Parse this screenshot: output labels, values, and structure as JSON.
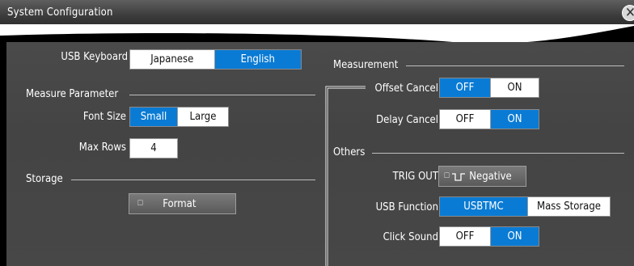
{
  "window": {
    "title": "System Configuration",
    "close_glyph": "✕"
  },
  "usb_keyboard": {
    "label": "USB Keyboard",
    "options": [
      "Japanese",
      "English"
    ],
    "selected": "English"
  },
  "measure_parameter": {
    "section": "Measure Parameter",
    "font_size": {
      "label": "Font Size",
      "options": [
        "Small",
        "Large"
      ],
      "selected": "Small"
    },
    "max_rows": {
      "label": "Max Rows",
      "value": "4"
    }
  },
  "storage": {
    "section": "Storage",
    "format_button": {
      "icon": "menu-icon",
      "label": "Format"
    }
  },
  "measurement": {
    "section": "Measurement",
    "offset_cancel": {
      "label": "Offset Cancel",
      "options": [
        "OFF",
        "ON"
      ],
      "selected": "OFF"
    },
    "delay_cancel": {
      "label": "Delay Cancel",
      "options": [
        "OFF",
        "ON"
      ],
      "selected": "ON"
    }
  },
  "others": {
    "section": "Others",
    "trig_out": {
      "label": "TRIG OUT",
      "icon": "menu-icon",
      "waveform_icon": "negative-pulse-icon",
      "value": "Negative"
    },
    "usb_function": {
      "label": "USB Function",
      "options": [
        "USBTMC",
        "Mass Storage"
      ],
      "selected": "USBTMC"
    },
    "click_sound": {
      "label": "Click Sound",
      "options": [
        "OFF",
        "ON"
      ],
      "selected": "ON"
    }
  },
  "colors": {
    "selected": "#0a7bd4",
    "panel": "#464646",
    "titlebar": "#4a4a4a"
  }
}
